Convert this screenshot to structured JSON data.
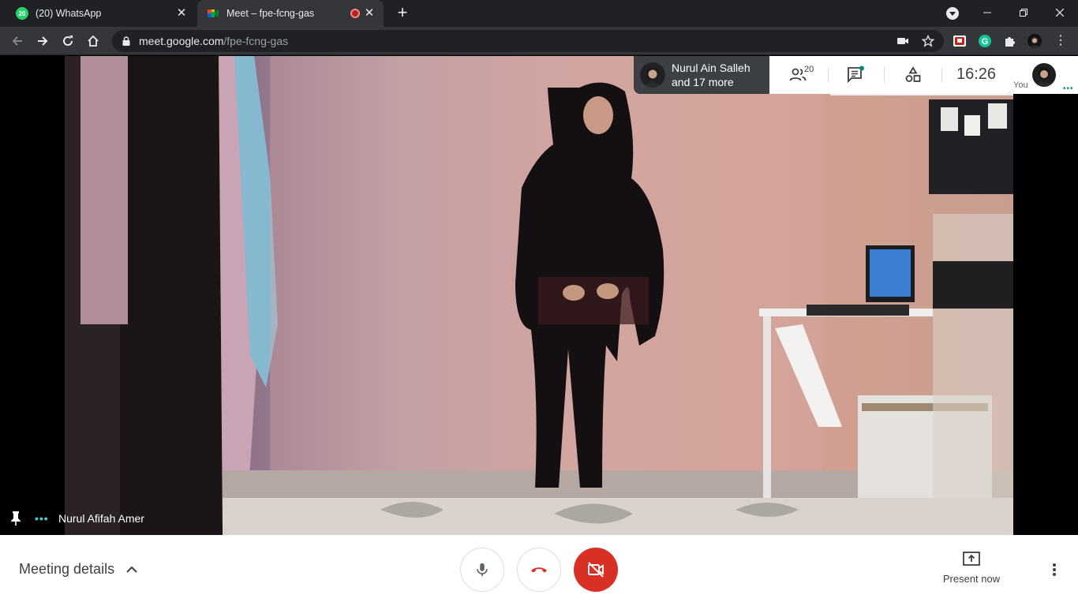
{
  "browser": {
    "tabs": [
      {
        "title": "(20) WhatsApp",
        "favicon": "whatsapp-icon",
        "badge": "20",
        "active": false
      },
      {
        "title": "Meet – fpe-fcng-gas",
        "favicon": "google-meet-icon",
        "recording": true,
        "active": true
      }
    ],
    "url_host": "meet.google.com",
    "url_path": "/fpe-fcng-gas"
  },
  "meet": {
    "participants_chip": {
      "line1": "Nurul Ain Salleh",
      "line2": "and 17 more"
    },
    "participant_count": "20",
    "clock": "16:26",
    "self_label": "You",
    "active_speaker": "Nurul Afifah Amer",
    "meeting_details_label": "Meeting details",
    "present_now_label": "Present now",
    "mic_state": "on",
    "camera_state": "off"
  },
  "colors": {
    "accent_red": "#d93025",
    "speaking_teal": "#4ecdc4",
    "chrome_dark": "#202124",
    "chrome_toolbar": "#35363a"
  }
}
